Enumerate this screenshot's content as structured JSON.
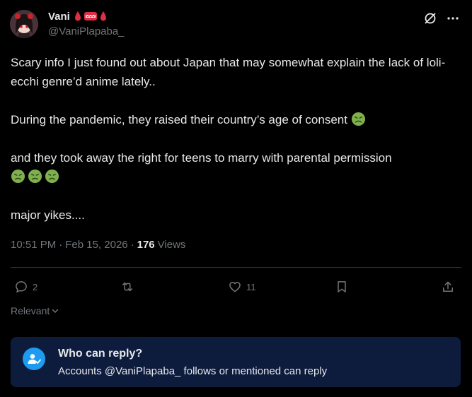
{
  "author": {
    "display_name": "Vani",
    "handle": "@VaniPlapaba_",
    "name_emojis": [
      "blood-drop-icon",
      "red-mask-icon",
      "blood-drop-icon"
    ]
  },
  "tweet": {
    "paragraphs": [
      "Scary info I just found out about Japan that may somewhat explain the lack of loli-ecchi genre’d anime lately..",
      "During the pandemic, they raised their country’s age of consent",
      "and they took away the right for teens to marry with parental permission",
      "major yikes...."
    ],
    "emoji": "nauseated-face-icon"
  },
  "meta": {
    "time": "10:51 PM",
    "separator": "·",
    "date": "Feb 15, 2026",
    "views_count": "176",
    "views_label": "Views"
  },
  "actions": {
    "replies": "2",
    "reposts": "",
    "likes": "11"
  },
  "sort": {
    "label": "Relevant"
  },
  "reply_restriction": {
    "title": "Who can reply?",
    "subtitle": "Accounts @VaniPlapaba_ follows or mentioned can reply"
  },
  "colors": {
    "background": "#000000",
    "text": "#e7e9ea",
    "muted": "#71767b",
    "divider": "#2f3336",
    "accent": "#1d9bf0",
    "reply_box": "#0d1b3d",
    "sick_emoji": "#7fb04d"
  }
}
